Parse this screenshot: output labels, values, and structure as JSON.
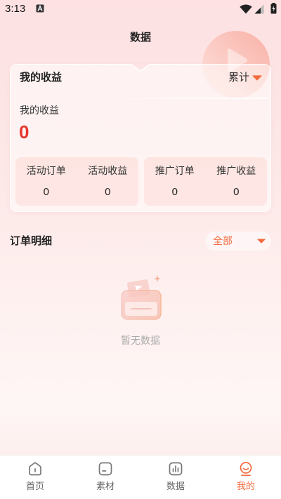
{
  "status_bar": {
    "time": "3:13",
    "icons": [
      "a-notification-icon",
      "wifi-icon",
      "signal-icon",
      "battery-icon"
    ]
  },
  "header": {
    "title": "数据"
  },
  "earnings_card": {
    "title": "我的收益",
    "period_selector": {
      "label": "累计",
      "icon": "caret-down-icon"
    },
    "total_label": "我的收益",
    "total_value": "0",
    "stats_groups": [
      {
        "items": [
          {
            "label": "活动订单",
            "value": "0"
          },
          {
            "label": "活动收益",
            "value": "0"
          }
        ]
      },
      {
        "items": [
          {
            "label": "推广订单",
            "value": "0"
          },
          {
            "label": "推广收益",
            "value": "0"
          }
        ]
      }
    ]
  },
  "orders": {
    "title": "订单明细",
    "filter": {
      "label": "全部",
      "icon": "caret-down-icon"
    },
    "empty_icon": "empty-box-icon",
    "empty_text": "暂无数据"
  },
  "bottom_nav": {
    "items": [
      {
        "label": "首页",
        "icon": "home-icon",
        "active": false
      },
      {
        "label": "素材",
        "icon": "material-icon",
        "active": false
      },
      {
        "label": "数据",
        "icon": "chart-icon",
        "active": false
      },
      {
        "label": "我的",
        "icon": "profile-icon",
        "active": true
      }
    ]
  },
  "theme": {
    "accent": "#f26b3f",
    "value_red": "#e8372c",
    "muted_text": "#a9a9a9",
    "nav_text": "#666666"
  }
}
